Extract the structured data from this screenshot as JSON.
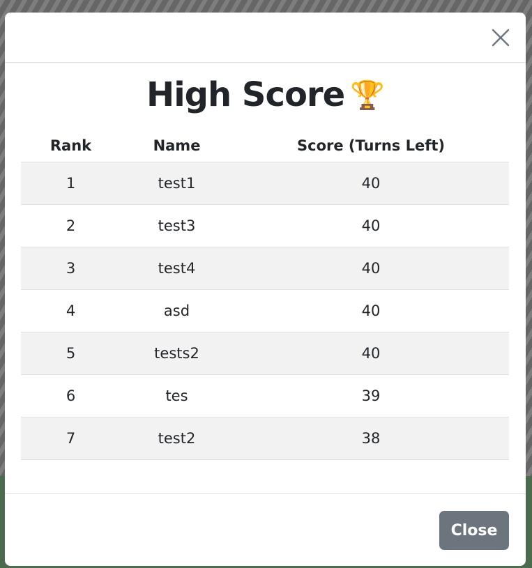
{
  "modal": {
    "title": "High Score",
    "title_icon": "trophy-icon",
    "title_glyph": "🏆",
    "close_icon": "close-icon"
  },
  "table": {
    "headers": {
      "rank": "Rank",
      "name": "Name",
      "score": "Score (Turns Left)"
    },
    "rows": [
      {
        "rank": "1",
        "name": "test1",
        "score": "40"
      },
      {
        "rank": "2",
        "name": "test3",
        "score": "40"
      },
      {
        "rank": "3",
        "name": "test4",
        "score": "40"
      },
      {
        "rank": "4",
        "name": "asd",
        "score": "40"
      },
      {
        "rank": "5",
        "name": "tests2",
        "score": "40"
      },
      {
        "rank": "6",
        "name": "tes",
        "score": "39"
      },
      {
        "rank": "7",
        "name": "test2",
        "score": "38"
      }
    ]
  },
  "footer": {
    "close_label": "Close"
  },
  "colors": {
    "close_button_bg": "#6c757d",
    "striped_row_bg": "#f2f2f2",
    "text": "#212529"
  }
}
